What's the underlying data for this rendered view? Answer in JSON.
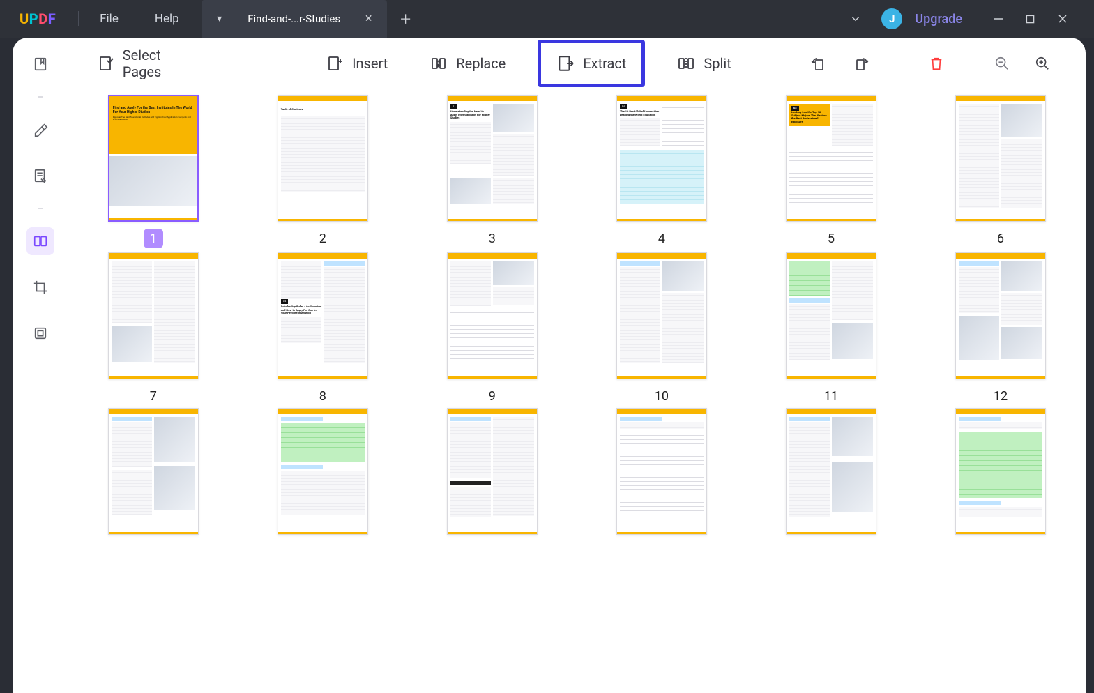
{
  "logo": {
    "u": "U",
    "p": "P",
    "d": "D",
    "f": "F"
  },
  "menu": {
    "file": "File",
    "help": "Help"
  },
  "tab": {
    "title": "Find-and-...r-Studies"
  },
  "avatar_initial": "J",
  "upgrade_label": "Upgrade",
  "toolbar": {
    "select_pages": "Select Pages",
    "insert": "Insert",
    "replace": "Replace",
    "extract": "Extract",
    "split": "Split"
  },
  "pages": {
    "p1": "1",
    "p2": "2",
    "p3": "3",
    "p4": "4",
    "p5": "5",
    "p6": "6",
    "p7": "7",
    "p8": "8",
    "p9": "9",
    "p10": "10",
    "p11": "11",
    "p12": "12"
  },
  "thumbs": {
    "p1_title": "Find and Apply For the Best Institutes In The World For Your Higher Studies",
    "p1_sub": "Discover The Best Educational Institutes and Tighten Your Application For Quick and Effective Results",
    "p2_toc": "Table of Contents",
    "p3_tag": "01",
    "p3_title": "Understanding the Need to Apply Internationally For Higher Studies",
    "p4_tag": "02",
    "p4_title": "The 10 Best Global Universities Leading the World Education",
    "p5_tag": "03",
    "p5_title": "Looking Into the Top 10 Subject Majors That Feature the Best Professional Exposure",
    "p8_tag": "04",
    "p8_title": "Scholarship Rules - An Overview and How to Apply For One In Your Favorite Institution"
  }
}
